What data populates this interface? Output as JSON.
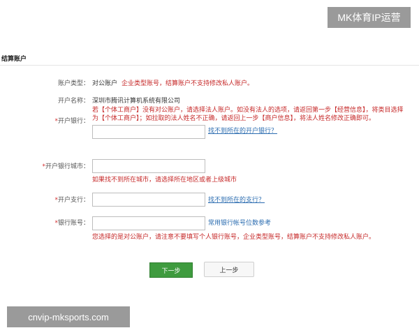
{
  "brand_badge": "MK体育IP运营",
  "section_title": "结算账户",
  "fields": {
    "account_type": {
      "label": "账户类型：",
      "value": "对公账户",
      "note": "企业类型账号，结算账户不支持修改私人账户。"
    },
    "account_name": {
      "label": "开户名称：",
      "value": "深圳市腾讯计算机系统有限公司"
    },
    "bank": {
      "required_mark": "*",
      "label": "开户银行：",
      "note_line1": "若【个体工商户】没有对公账户，请选择法人账户。如没有法人的选项，请返回第一步【经营信息】，将类目选择",
      "note_line2": "为【个体工商户】；如拉取的法人姓名不正确，请返回上一步【商户信息】，将法人姓名修改正确即可。",
      "input_value": "",
      "link": "找不到所在的开户银行？"
    },
    "bank_city": {
      "required_mark": "*",
      "label": "开户银行城市：",
      "input_value": "",
      "note": "如果找不到所在城市，请选择所在地区或者上级城市"
    },
    "branch": {
      "required_mark": "*",
      "label": "开户支行：",
      "input_value": "",
      "link": "找不到所在的支行？"
    },
    "account_number": {
      "required_mark": "*",
      "label": "银行账号：",
      "input_value": "",
      "hint": "常用银行帐号位数参考",
      "note": "您选择的是对公账户，请注意不要填写个人银行账号，企业类型账号，结算账户不支持修改私人账户。"
    }
  },
  "buttons": {
    "next": "下一步",
    "prev": "上一步"
  },
  "watermark": "cnvip-mksports.com"
}
